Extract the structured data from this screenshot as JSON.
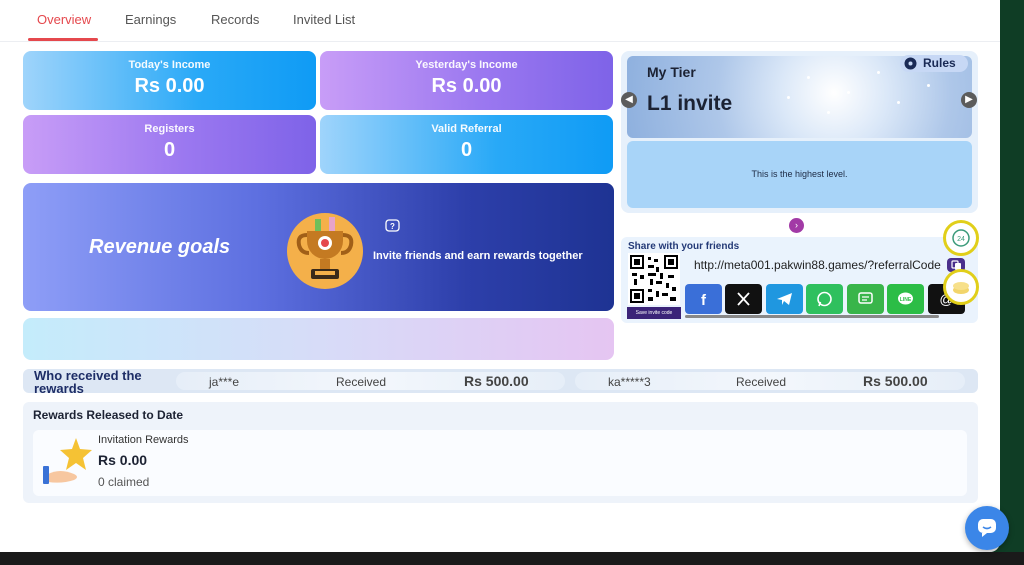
{
  "tabs": [
    {
      "label": "Overview",
      "active": true
    },
    {
      "label": "Earnings",
      "active": false
    },
    {
      "label": "Records",
      "active": false
    },
    {
      "label": "Invited List",
      "active": false
    }
  ],
  "stats": {
    "today_income": {
      "label": "Today's Income",
      "value": "Rs  0.00"
    },
    "yesterday_income": {
      "label": "Yesterday's Income",
      "value": "Rs  0.00"
    },
    "registers": {
      "label": "Registers",
      "value": "0"
    },
    "valid_referral": {
      "label": "Valid Referral",
      "value": "0"
    }
  },
  "revenue": {
    "title": "Revenue goals",
    "subtitle": "Invite friends and earn rewards together",
    "help_icon": "question-icon",
    "trophy_icon": "trophy-icon"
  },
  "tier": {
    "label": "My Tier",
    "name": "L1 invite",
    "rules_label": "Rules",
    "info": "This is the highest level."
  },
  "share": {
    "title": "Share with your friends",
    "link": "http://meta001.pakwin88.games/?referralCode",
    "qr_caption": "Save invite code",
    "socials": [
      {
        "name": "facebook",
        "color": "#3a6fd8"
      },
      {
        "name": "x",
        "color": "#111111"
      },
      {
        "name": "telegram",
        "color": "#1f97e0"
      },
      {
        "name": "whatsapp",
        "color": "#2fc05e"
      },
      {
        "name": "sms",
        "color": "#39b54a"
      },
      {
        "name": "line",
        "color": "#2cbd46"
      },
      {
        "name": "email",
        "color": "#111111"
      }
    ]
  },
  "who_received": {
    "title": "Who received the rewards",
    "entries": [
      {
        "user": "ja***e",
        "status": "Received",
        "amount": "Rs  500.00"
      },
      {
        "user": "ka*****3",
        "status": "Received",
        "amount": "Rs  500.00"
      }
    ]
  },
  "released": {
    "title": "Rewards Released to Date",
    "item_name": "Invitation Rewards",
    "amount": "Rs  0.00",
    "claimed": "0 claimed"
  },
  "colors": {
    "accent": "#e5484d",
    "card_blue": "#29a9f7",
    "card_purple": "#9b78f0",
    "revenue_dark": "#1e3393"
  }
}
